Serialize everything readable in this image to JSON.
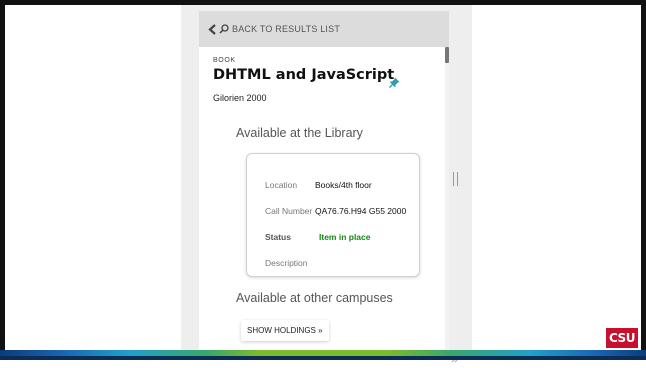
{
  "back_bar": {
    "label": "BACK TO RESULTS LIST"
  },
  "record": {
    "type": "BOOK",
    "title": "DHTML and JavaScript",
    "author_year": "Gilorien 2000"
  },
  "availability": {
    "heading": "Available at the Library",
    "fields": {
      "location_label": "Location",
      "location_value": "Books/4th floor",
      "call_number_label": "Call Number",
      "call_number_value": "QA76.76.H94 G55 2000",
      "status_label": "Status",
      "status_value": "Item in place",
      "description_label": "Description"
    }
  },
  "other_campuses": {
    "heading": "Available at other campuses",
    "button_label": "SHOW HOLDINGS »"
  },
  "logo": {
    "text": "CSU"
  },
  "colors": {
    "status_green": "#138a0f",
    "back_bar_bg": "#dcdcdc",
    "pin_teal": "#2a9fb0",
    "logo_red": "#c8102e"
  }
}
